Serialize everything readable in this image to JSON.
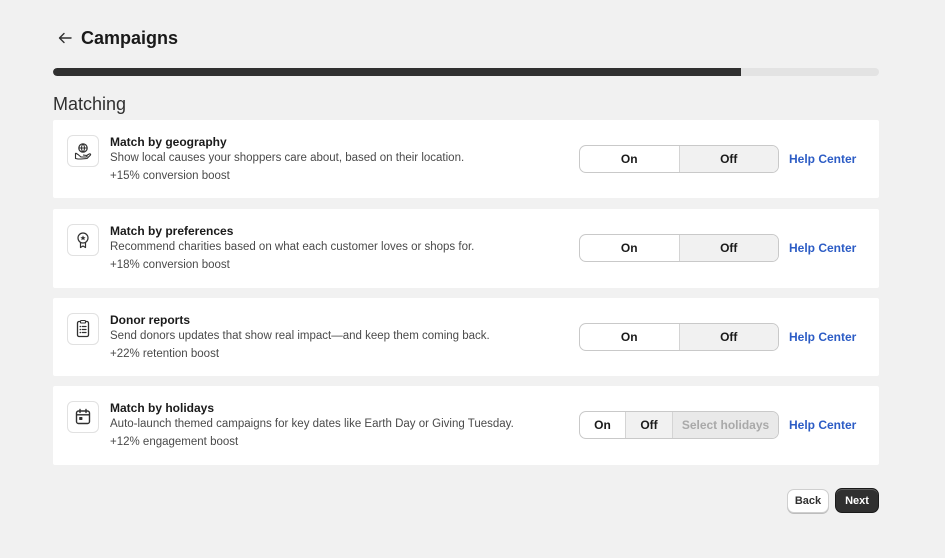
{
  "header": {
    "title": "Campaigns",
    "back_icon": "arrow-left-icon"
  },
  "progress": {
    "percent": 83.3
  },
  "section": {
    "title": "Matching"
  },
  "cards": [
    {
      "icon": "hand-globe-icon",
      "title": "Match by geography",
      "description": "Show local causes your shoppers care about, based on their location.",
      "boost": "+15% conversion boost",
      "on_label": "On",
      "off_label": "Off",
      "selected": "Off",
      "help_label": "Help Center"
    },
    {
      "icon": "award-ribbon-icon",
      "title": "Match by preferences",
      "description": "Recommend charities based on what each customer loves or shops for.",
      "boost": "+18% conversion boost",
      "on_label": "On",
      "off_label": "Off",
      "selected": "Off",
      "help_label": "Help Center"
    },
    {
      "icon": "report-document-icon",
      "title": "Donor reports",
      "description": "Send donors updates that show real impact—and keep them coming back.",
      "boost": "+22% retention boost",
      "on_label": "On",
      "off_label": "Off",
      "selected": "Off",
      "help_label": "Help Center"
    },
    {
      "icon": "calendar-icon",
      "title": "Match by holidays",
      "description": "Auto-launch themed campaigns for key dates like Earth Day or Giving Tuesday.",
      "boost": "+12% engagement boost",
      "on_label": "On",
      "off_label": "Off",
      "select_label": "Select holidays",
      "selected": "Off",
      "help_label": "Help Center"
    }
  ],
  "footer": {
    "back_label": "Back",
    "next_label": "Next"
  },
  "colors": {
    "background": "#f1f1f1",
    "card": "#ffffff",
    "progress_fill": "#303030",
    "progress_track": "#e3e3e3",
    "link": "#2c5cc5",
    "primary_button": "#303030"
  }
}
